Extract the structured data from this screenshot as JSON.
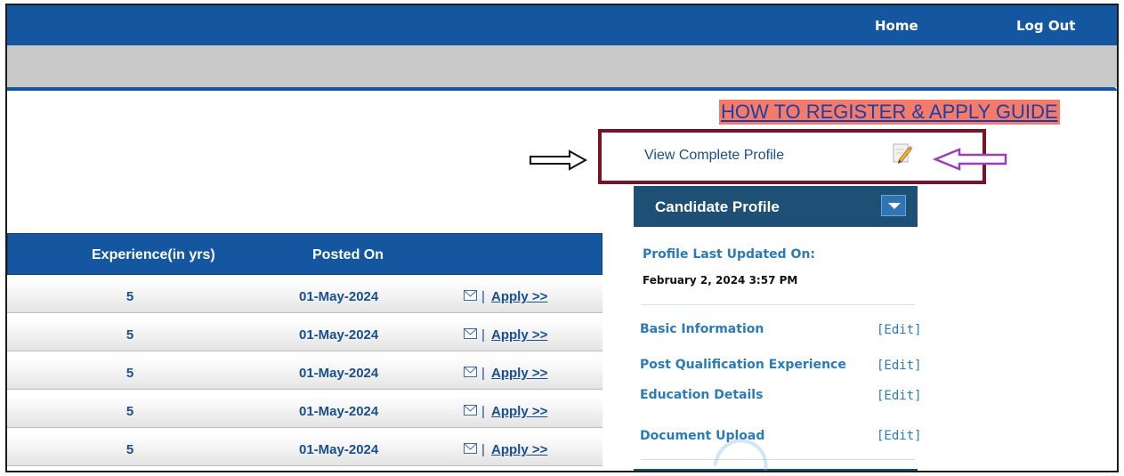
{
  "nav": {
    "home": "Home",
    "logout": "Log Out"
  },
  "guide_link": "HOW TO REGISTER & APPLY GUIDE",
  "view_profile": "View Complete Profile",
  "table": {
    "headers": {
      "experience": "Experience(in yrs)",
      "posted_on": "Posted On"
    },
    "rows": [
      {
        "experience": "5",
        "posted_on": "01-May-2024",
        "separator": "|",
        "apply": "Apply >>"
      },
      {
        "experience": "5",
        "posted_on": "01-May-2024",
        "separator": "|",
        "apply": "Apply >>"
      },
      {
        "experience": "5",
        "posted_on": "01-May-2024",
        "separator": "|",
        "apply": "Apply >>"
      },
      {
        "experience": "5",
        "posted_on": "01-May-2024",
        "separator": "|",
        "apply": "Apply >>"
      },
      {
        "experience": "5",
        "posted_on": "01-May-2024",
        "separator": "|",
        "apply": "Apply >>"
      }
    ]
  },
  "candidate_profile": {
    "title": "Candidate Profile",
    "last_updated_label": "Profile Last Updated On:",
    "last_updated_value": "February 2, 2024 3:57 PM",
    "items": [
      {
        "label": "Basic Information",
        "edit": "[Edit]"
      },
      {
        "label": "Post Qualification Experience",
        "edit": "[Edit]"
      },
      {
        "label": "Education Details",
        "edit": "[Edit]"
      },
      {
        "label": "Document Upload",
        "edit": "[Edit]"
      }
    ]
  },
  "colors": {
    "nav_blue": "#1457a0",
    "panel_header": "#1e4f75",
    "guide_bg": "#f47a6a",
    "highlight_border": "#7a1425",
    "annotation_arrow": "#9b3fb8"
  },
  "icons": [
    "edit-profile-icon",
    "mail-icon",
    "chevron-down-icon",
    "arrow-right-icon",
    "arrow-left-icon"
  ]
}
